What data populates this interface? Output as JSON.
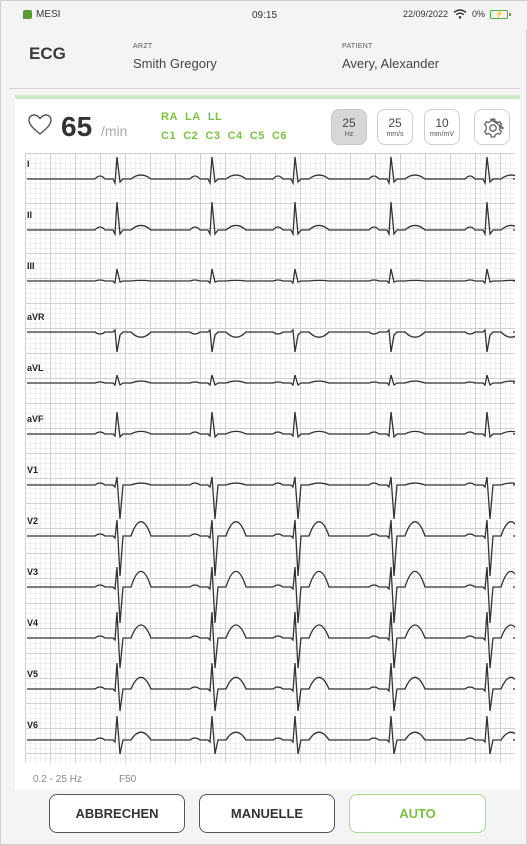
{
  "status_bar": {
    "carrier": "MESI",
    "time": "09:15",
    "date": "22/09/2022",
    "battery": "0%"
  },
  "header": {
    "title": "ECG",
    "doctor_label": "ARZT",
    "doctor_name": "Smith Gregory",
    "patient_label": "PATIENT",
    "patient_name": "Avery, Alexander"
  },
  "vitals": {
    "heart_rate": "65",
    "heart_rate_unit": "/min"
  },
  "electrodes": {
    "limb": [
      "RA",
      "LA",
      "LL"
    ],
    "chest": [
      "C1",
      "C2",
      "C3",
      "C4",
      "C5",
      "C6"
    ],
    "color": "#7bc043"
  },
  "controls": {
    "filter": {
      "value": "25",
      "unit": "Hz",
      "active": true
    },
    "speed": {
      "value": "25",
      "unit": "mm/s",
      "active": false
    },
    "gain": {
      "value": "10",
      "unit": "mm/mV",
      "active": false
    },
    "settings_icon": "gear-icon"
  },
  "leads": [
    "I",
    "II",
    "III",
    "aVR",
    "aVL",
    "aVF",
    "V1",
    "V2",
    "V3",
    "V4",
    "V5",
    "V6"
  ],
  "footer": {
    "bandwidth": "0.2 - 25 Hz",
    "notch": "F50"
  },
  "buttons": {
    "cancel": "ABBRECHEN",
    "manual": "MANUELLE",
    "auto": "AUTO"
  },
  "colors": {
    "accent": "#7bc043",
    "trace": "#333333"
  }
}
